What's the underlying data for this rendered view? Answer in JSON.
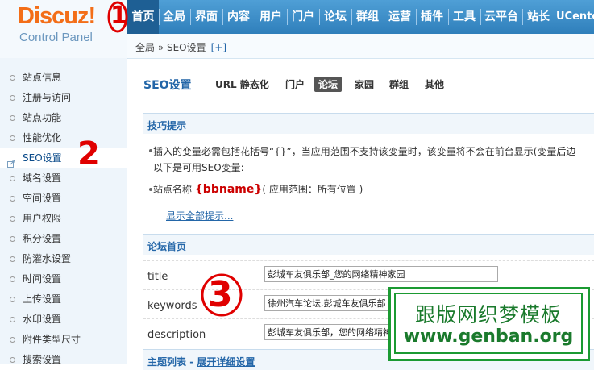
{
  "logo": {
    "brand_a": "Discuz",
    "brand_c": "!",
    "subtitle": "Control Panel"
  },
  "nav": {
    "items": [
      "首页",
      "全局",
      "界面",
      "内容",
      "用户",
      "门户",
      "论坛",
      "群组",
      "运营",
      "插件",
      "工具",
      "云平台",
      "站长",
      "UCenter"
    ],
    "active_index": 0
  },
  "breadcrumb": {
    "text": "全局 » SEO设置",
    "plus": "[+]"
  },
  "sidebar": {
    "items": [
      "站点信息",
      "注册与访问",
      "站点功能",
      "性能优化",
      "SEO设置",
      "域名设置",
      "空间设置",
      "用户权限",
      "积分设置",
      "防灌水设置",
      "时间设置",
      "上传设置",
      "水印设置",
      "附件类型尺寸",
      "搜索设置"
    ],
    "active_index": 4
  },
  "page": {
    "title": "SEO设置",
    "tabs": [
      "URL 静态化",
      "门户",
      "论坛",
      "家园",
      "群组",
      "其他"
    ],
    "active_tab": 2
  },
  "tips": {
    "heading": "技巧提示",
    "line1": "插入的变量必需包括花括号“{}”，当应用范围不支持该变量时，该变量将不会在前台显示(变量后边",
    "line2": "以下是可用SEO变量:",
    "var_label": "站点名称",
    "var_name": "{bbname}",
    "var_scope": "( 应用范围：所有位置 )",
    "show_all": "显示全部提示..."
  },
  "forum_home": {
    "heading": "论坛首页",
    "fields": [
      {
        "label": "title",
        "value": "彭城车友俱乐部_您的网络精神家园"
      },
      {
        "label": "keywords",
        "value": "徐州汽车论坛,彭城车友俱乐部"
      },
      {
        "label": "description",
        "value": "彭城车友俱乐部，您的网络精神家园"
      }
    ]
  },
  "next_section": {
    "heading": "主题列表",
    "expand": "展开详细设置"
  },
  "annotations": [
    "1",
    "2",
    "3"
  ],
  "watermark": {
    "line1": "跟版网织梦模板",
    "line2": "www.genban.org"
  },
  "colors": {
    "nav_blue": "#2f7fbb",
    "active_nav": "#1e5f94",
    "link_blue": "#2366a8",
    "annotation_red": "#e00000",
    "watermark_green": "#1b9a32",
    "brand_orange": "#f36e18"
  }
}
